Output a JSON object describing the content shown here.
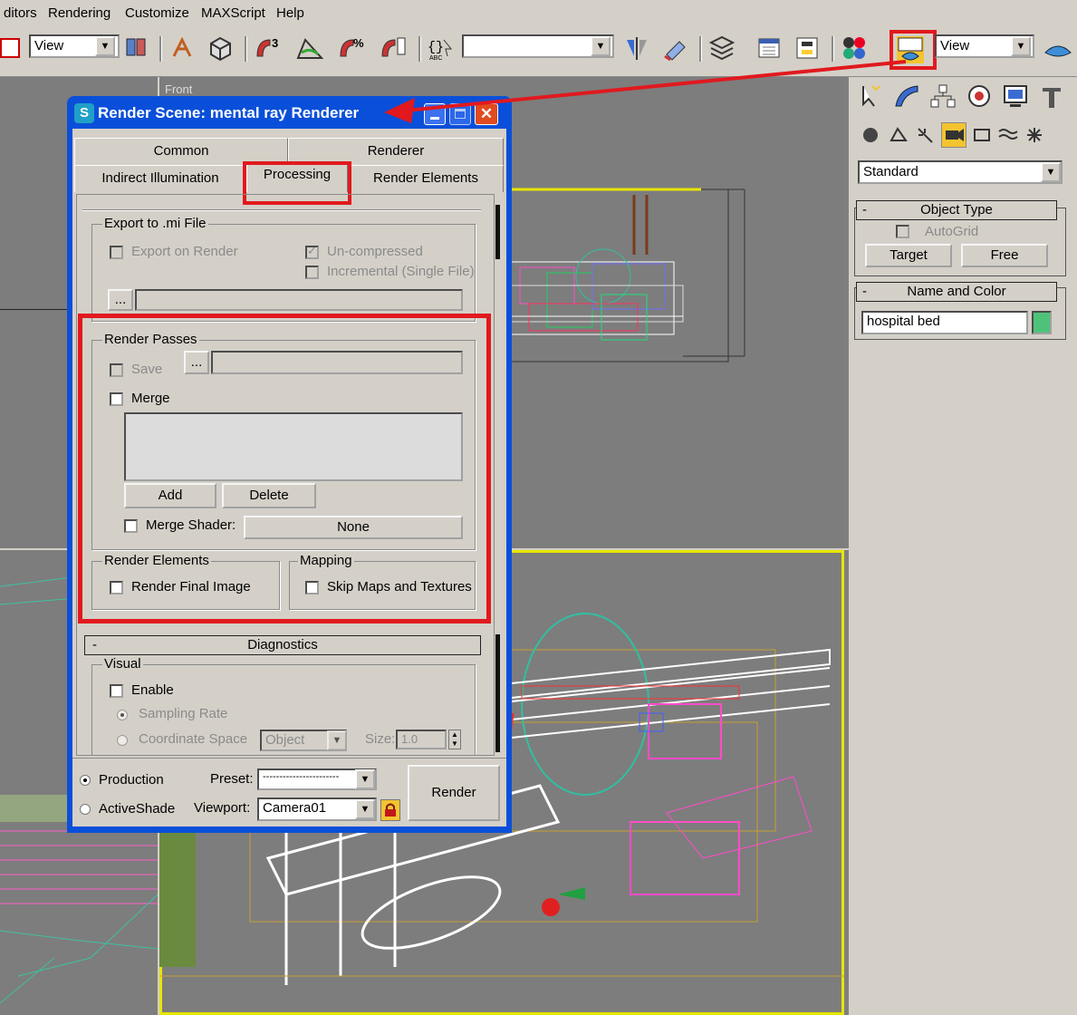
{
  "menu": [
    "ditors",
    "Rendering",
    "Customize",
    "MAXScript",
    "Help"
  ],
  "toolbar": {
    "view_combo_left": "View",
    "named_selection": "",
    "view_combo_right": "View"
  },
  "viewport": {
    "front_label": "Front"
  },
  "command_panel": {
    "category": "Standard",
    "object_type_title": "Object Type",
    "object_type_collapse": "-",
    "autogrid_label": "AutoGrid",
    "target_button": "Target",
    "free_button": "Free",
    "name_color_title": "Name and Color",
    "name_color_collapse": "-",
    "object_name": "hospital bed",
    "object_color": "#4fc27a"
  },
  "dialog": {
    "title": "Render Scene: mental ray Renderer",
    "tabs_row1": [
      "Common",
      "Renderer"
    ],
    "tabs_row2": [
      "Indirect Illumination",
      "Processing",
      "Render Elements"
    ],
    "active_tab": "Processing",
    "export_group": {
      "title": "Export to .mi File",
      "export_on_render": "Export on Render",
      "uncompressed": "Un-compressed",
      "incremental": "Incremental (Single File)",
      "browse": "..."
    },
    "render_passes": {
      "title": "Render Passes",
      "save_label": "Save",
      "browse": "...",
      "merge_label": "Merge",
      "add_button": "Add",
      "delete_button": "Delete",
      "merge_shader_label": "Merge Shader:",
      "merge_shader_value": "None"
    },
    "render_elements_group": {
      "title": "Render Elements",
      "final_image": "Render Final Image"
    },
    "mapping_group": {
      "title": "Mapping",
      "skip_maps": "Skip Maps and Textures"
    },
    "diagnostics": {
      "rollout": "Diagnostics",
      "collapse": "-",
      "visual_title": "Visual",
      "enable_label": "Enable",
      "sampling_rate": "Sampling Rate",
      "coordinate_space": "Coordinate Space",
      "coord_value": "Object",
      "size_label": "Size:",
      "size_value": "1.0"
    },
    "bottom": {
      "production": "Production",
      "activeshade": "ActiveShade",
      "preset_label": "Preset:",
      "preset_value": "-----------------------",
      "viewport_label": "Viewport:",
      "viewport_value": "Camera01",
      "render_button": "Render"
    }
  },
  "colors": {
    "highlight_red": "#e1191e",
    "title_blue": "#0a4fd9",
    "viewport_active": "#e6e600"
  }
}
